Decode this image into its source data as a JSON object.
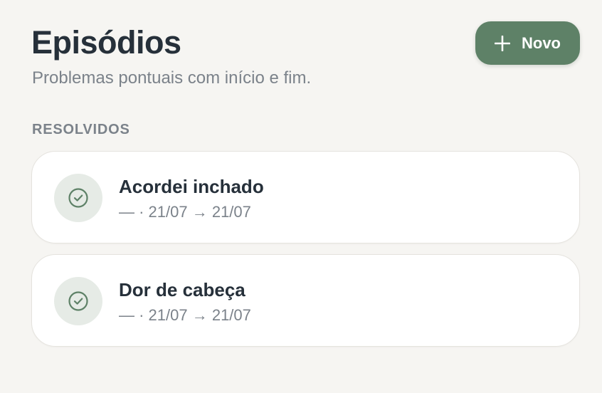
{
  "header": {
    "title": "Episódios",
    "subtitle": "Problemas pontuais com início e fim.",
    "new_button_label": "Novo",
    "new_button_icon": "plus-icon"
  },
  "colors": {
    "background": "#f6f5f2",
    "accent": "#5e8167",
    "badge_bg": "#e6ebe6",
    "text_primary": "#26303a",
    "text_secondary": "#7b828a"
  },
  "section": {
    "label": "RESOLVIDOS"
  },
  "episodes": [
    {
      "title": "Acordei inchado",
      "meta": "— · 21/07 → 21/07",
      "status_icon": "check-circle-icon"
    },
    {
      "title": "Dor de cabeça",
      "meta": "— · 21/07 → 21/07",
      "status_icon": "check-circle-icon"
    }
  ]
}
